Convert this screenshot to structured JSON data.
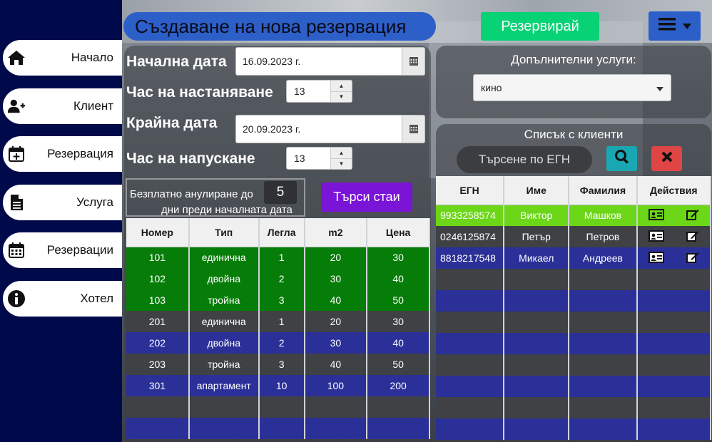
{
  "sidebar": {
    "items": [
      {
        "label": "Начало",
        "icon": "home-icon"
      },
      {
        "label": "Клиент",
        "icon": "add-user-icon"
      },
      {
        "label": "Резервация",
        "icon": "calendar-plus-icon"
      },
      {
        "label": "Услуга",
        "icon": "document-icon"
      },
      {
        "label": "Резервации",
        "icon": "calendar-icon"
      },
      {
        "label": "Хотел",
        "icon": "info-icon"
      }
    ]
  },
  "header": {
    "title": "Създаване на нова резервация",
    "reserve_label": "Резервирай"
  },
  "form": {
    "start_date_label": "Начална дата",
    "start_date_value": "16.09.2023 г.",
    "checkin_hour_label": "Час на настаняване",
    "checkin_hour_value": "13",
    "end_date_label": "Крайна дата",
    "end_date_value": "20.09.2023 г.",
    "checkout_hour_label": "Час на напускане",
    "checkout_hour_value": "13",
    "cancel_text_1": "Безплатно анулиране до",
    "cancel_text_2": "дни преди началната дата",
    "cancel_days": "5",
    "search_rooms_label": "Търси стаи"
  },
  "rooms": {
    "headers": [
      "Номер",
      "Тип",
      "Легла",
      "m2",
      "Цена"
    ],
    "rows": [
      {
        "number": "101",
        "type": "единична",
        "beds": "1",
        "m2": "20",
        "price": "30",
        "style": "green"
      },
      {
        "number": "102",
        "type": "двойна",
        "beds": "2",
        "m2": "30",
        "price": "40",
        "style": "green"
      },
      {
        "number": "103",
        "type": "тройна",
        "beds": "3",
        "m2": "40",
        "price": "50",
        "style": "green"
      },
      {
        "number": "201",
        "type": "единична",
        "beds": "1",
        "m2": "20",
        "price": "30",
        "style": "grey"
      },
      {
        "number": "202",
        "type": "двойна",
        "beds": "2",
        "m2": "30",
        "price": "40",
        "style": "blue"
      },
      {
        "number": "203",
        "type": "тройна",
        "beds": "3",
        "m2": "40",
        "price": "50",
        "style": "grey"
      },
      {
        "number": "301",
        "type": "апартамент",
        "beds": "10",
        "m2": "100",
        "price": "200",
        "style": "blue"
      }
    ]
  },
  "services": {
    "label": "Допълнителни услуги:",
    "selected": "кино"
  },
  "clients": {
    "title": "Списък с клиенти",
    "search_placeholder": "Търсене по ЕГН",
    "headers": [
      "ЕГН",
      "Име",
      "Фамилия",
      "Действия"
    ],
    "rows": [
      {
        "egn": "9933258574",
        "first": "Виктор",
        "last": "Машков",
        "style": "lime"
      },
      {
        "egn": "0246125874",
        "first": "Петър",
        "last": "Петров",
        "style": "grey"
      },
      {
        "egn": "8818217548",
        "first": "Микаел",
        "last": "Андреев",
        "style": "blue"
      }
    ]
  },
  "colors": {
    "sidebar_bg": "#000a4a",
    "title_pill": "#2d5fc8",
    "reserve_btn": "#07d275",
    "search_rooms_btn": "#7a14d6",
    "row_green": "#067d08",
    "row_grey": "#3f4144",
    "row_blue": "#2b3098",
    "row_lime": "#6cd619",
    "search_btn": "#19a8b3",
    "clear_btn": "#e04545"
  }
}
